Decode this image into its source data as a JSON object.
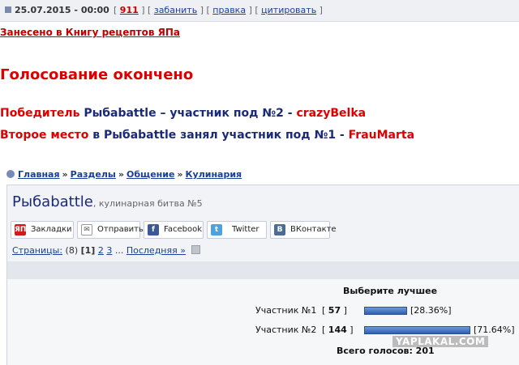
{
  "topbar": {
    "date": "25.07.2015 - 00:00",
    "count": "911",
    "links": [
      "забанить",
      "правка",
      "цитировать"
    ]
  },
  "post": {
    "recipe_link": "Занесено в Книгу рецептов ЯПа",
    "headline": "Голосование окончено",
    "winner": {
      "prefix": "Победитель",
      "contest": "Рыбаbattle",
      "middle": "– участник под №2 -",
      "name": "crazyBelka"
    },
    "second": {
      "prefix": "Второе место",
      "middle1": "в",
      "contest": "Рыбаbattle",
      "middle2": "занял участник под №1 -",
      "name": "FrauMarta"
    }
  },
  "breadcrumb": [
    "Главная",
    "Разделы",
    "Общение",
    "Кулинария"
  ],
  "breadcrumb_sep": "»",
  "topic": {
    "title": "Рыбаbattle",
    "subtitle": ", кулинарная битва №5"
  },
  "share": {
    "buttons": [
      {
        "label": "Закладки",
        "icon": "yap-icon",
        "icon_text": "ЯП",
        "color": "#d11a1a"
      },
      {
        "label": "Отправить",
        "icon": "mail-icon",
        "icon_text": "✉",
        "color": "#8a8f99"
      },
      {
        "label": "Facebook",
        "icon": "facebook-icon",
        "icon_text": "f",
        "color": "#3b5998"
      },
      {
        "label": "Twitter",
        "icon": "twitter-icon",
        "icon_text": "t",
        "color": "#4aa3df"
      },
      {
        "label": "ВКонтакте",
        "icon": "vk-icon",
        "icon_text": "B",
        "color": "#4c6c91"
      }
    ]
  },
  "pages": {
    "label": "Страницы:",
    "total": "(8)",
    "current": "[1]",
    "p2": "2",
    "p3": "3",
    "ellipsis": "...",
    "last": "Последняя »"
  },
  "poll": {
    "title": "Выберите лучшее",
    "options": [
      {
        "name": "Участник №1",
        "open": "[",
        "votes": "57",
        "close": "]",
        "percent": "[28.36%]",
        "fraction": 0.2836
      },
      {
        "name": "Участник №2",
        "open": "[",
        "votes": "144",
        "close": "]",
        "percent": "[71.64%]",
        "fraction": 0.7164
      }
    ],
    "total": "Всего голосов: 201"
  },
  "watermark": "YAPLAKAL.COM"
}
